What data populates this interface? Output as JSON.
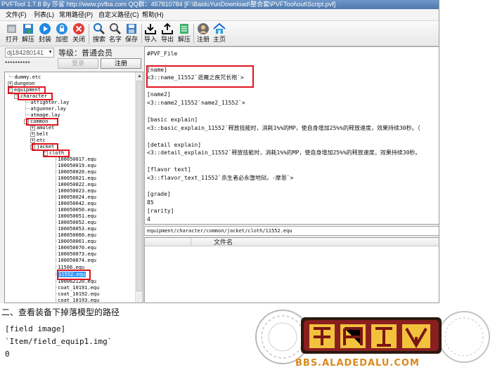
{
  "window": {
    "title": "PVFTool 1.7.8 By 莎鲨 http://www.pvfba.com QQ群：457810784 [F:\\BaiduYunDownload\\整合套\\PVFTool\\out\\Script.pvf]"
  },
  "menu": {
    "items": [
      "文件(F)",
      "列表(L)",
      "常用路径(P)",
      "自定义路径(C)",
      "帮助(H)"
    ]
  },
  "toolbar": {
    "buttons": [
      {
        "label": "打开",
        "icon": "open-icon"
      },
      {
        "label": "解压",
        "icon": "save-icon"
      },
      {
        "label": "封装",
        "icon": "play-icon"
      },
      {
        "label": "加密",
        "icon": "lock-icon"
      },
      {
        "label": "关闭",
        "icon": "close-icon"
      },
      {
        "label": "搜索",
        "icon": "search-icon"
      },
      {
        "label": "名字",
        "icon": "search-name-icon"
      },
      {
        "label": "保存",
        "icon": "floppy-icon"
      },
      {
        "label": "导入",
        "icon": "import-icon"
      },
      {
        "label": "导出",
        "icon": "export-icon"
      },
      {
        "label": "解压",
        "icon": "document-icon"
      },
      {
        "label": "注册",
        "icon": "user-icon"
      },
      {
        "label": "主页",
        "icon": "home-icon"
      }
    ]
  },
  "account": {
    "user": "dj184280141",
    "level_label": "等级：普通会员",
    "password_mask": "**********",
    "login_label": "登录",
    "register_label": "注册"
  },
  "tree": {
    "nodes": [
      {
        "label": "dummy.etc"
      },
      {
        "label": "dungeon",
        "toggle": "+"
      },
      {
        "label": "equipment",
        "toggle": "-"
      },
      {
        "label": "character",
        "toggle": "-"
      },
      {
        "label": "atfighter.lay"
      },
      {
        "label": "atgunner.lay"
      },
      {
        "label": "atmage.lay"
      },
      {
        "label": "common",
        "toggle": "-"
      },
      {
        "label": "amulet",
        "toggle": "+"
      },
      {
        "label": "belt",
        "toggle": "+"
      },
      {
        "label": "etc",
        "toggle": "+"
      },
      {
        "label": "jacket",
        "toggle": "-"
      },
      {
        "label": "cloth",
        "toggle": "-"
      },
      {
        "label": "100050017.equ"
      },
      {
        "label": "100050019.equ"
      },
      {
        "label": "100050020.equ"
      },
      {
        "label": "100050021.equ"
      },
      {
        "label": "100050022.equ"
      },
      {
        "label": "100050023.equ"
      },
      {
        "label": "100050024.equ"
      },
      {
        "label": "100050042.equ"
      },
      {
        "label": "100050050.equ"
      },
      {
        "label": "100050051.equ"
      },
      {
        "label": "100050052.equ"
      },
      {
        "label": "100050053.equ"
      },
      {
        "label": "100050060.equ"
      },
      {
        "label": "100050061.equ"
      },
      {
        "label": "100050070.equ"
      },
      {
        "label": "100050073.equ"
      },
      {
        "label": "100050074.equ"
      },
      {
        "label": "11506.equ"
      },
      {
        "label": "11552.equ",
        "selected": true
      },
      {
        "label": "100062120.equ"
      },
      {
        "label": "coat_10191.equ"
      },
      {
        "label": "coat_10192.equ"
      },
      {
        "label": "coat_10193.equ"
      }
    ]
  },
  "editor": {
    "lines": [
      "#PVF_File",
      "",
      "[name]",
      "<3::name_11552`逝魔之疾咒长袍`>",
      "",
      "[name2]",
      "<3::name2_11552`name2_11552`>",
      "",
      "[basic explain]",
      "<3::basic_explain_11552`释放技能时，消耗1%%的MP，使自身增加25%%的释放速度，效果持续30秒。（",
      "",
      "[detail explain]",
      "<3::detail_explain_11552`释放技能时，消耗1%%的MP，使自身增加25%%的释放速度，效果持续30秒。",
      "",
      "[flavor text]",
      "<3::flavor_text_11552`杀生者必永堕地狱。-摩恩`>",
      "",
      "[grade]",
      "85",
      "[rarity]",
      "4"
    ]
  },
  "path_bar": "equipment/character/common/jacket/cloth/11552.equ",
  "file_list": {
    "column_header": "文件名"
  },
  "caption": "二、查看装备下掉落模型的路径",
  "code": {
    "lines": [
      "[field image]",
      "`Item/field_equip1.img`",
      "0"
    ]
  },
  "banner": {
    "url": "BBS.ALADEDALU.COM"
  },
  "colors": {
    "highlight_red": "#e0141e",
    "selection_blue": "#3399ff",
    "banner_orange": "#d98a1e"
  }
}
